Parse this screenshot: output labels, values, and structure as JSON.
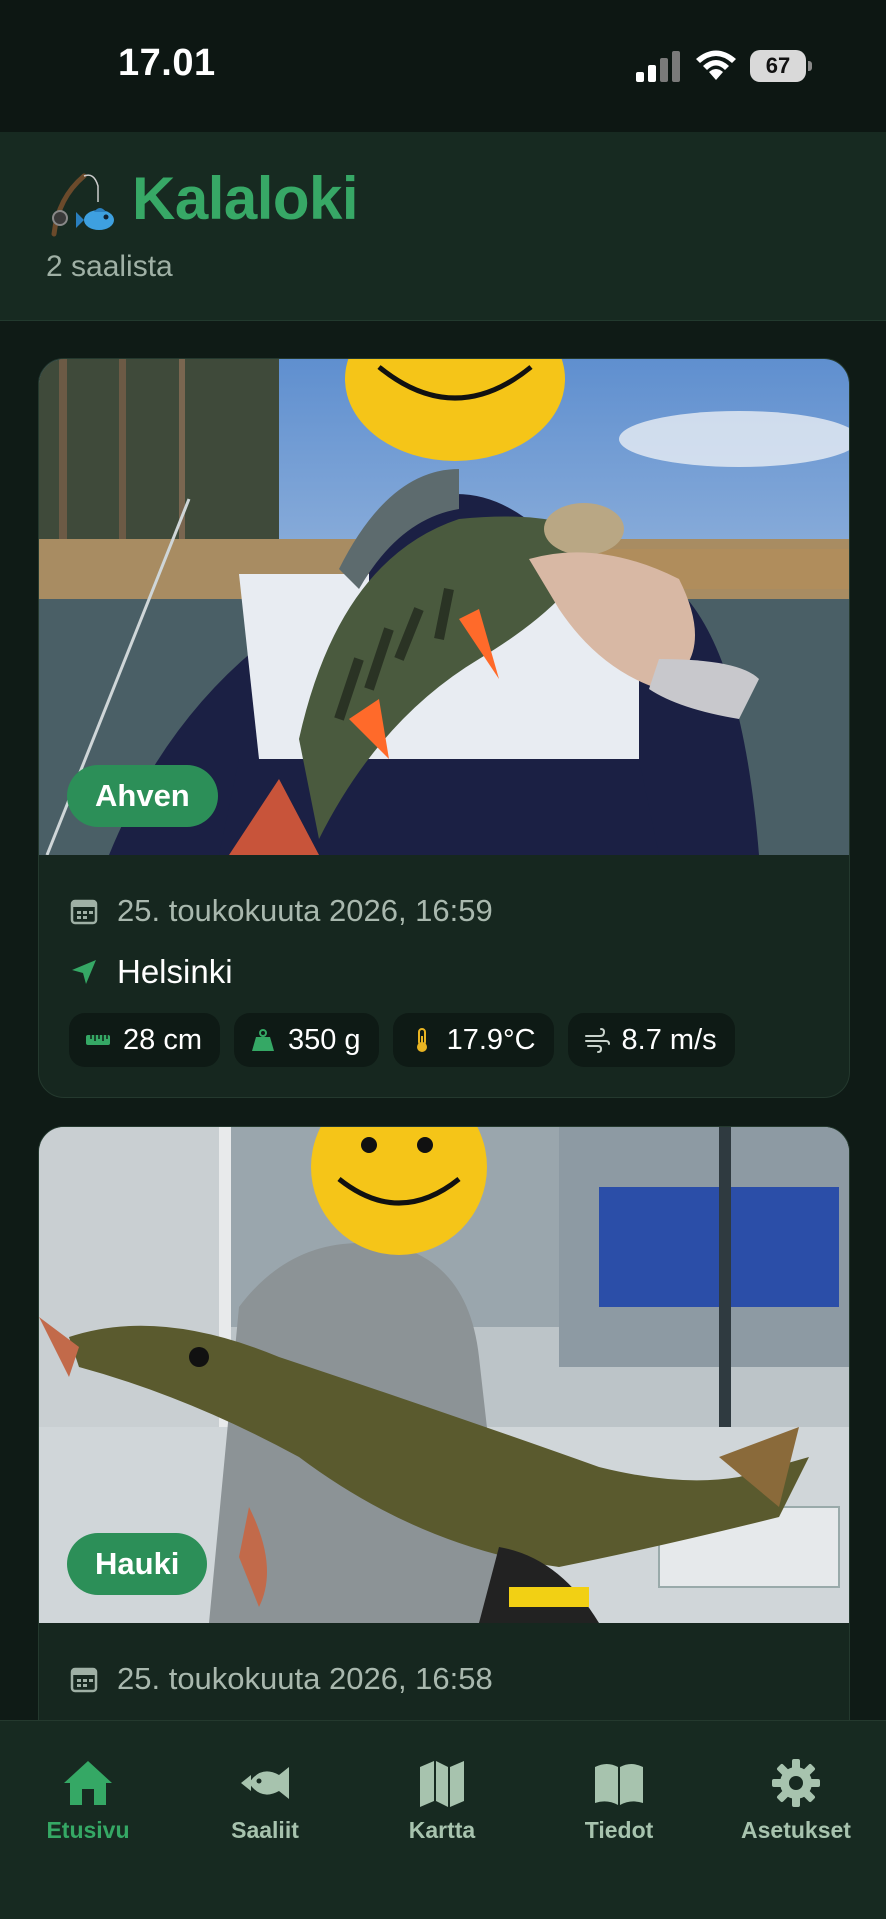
{
  "status_bar": {
    "time": "17.01",
    "battery": "67"
  },
  "header": {
    "title": "Kalaloki",
    "subtitle": "2 saalista",
    "icon": "fishing-icon"
  },
  "catches": [
    {
      "species": "Ahven",
      "date": "25. toukokuuta 2026, 16:59",
      "location": "Helsinki",
      "length": "28 cm",
      "weight": "350 g",
      "temperature": "17.9°C",
      "wind": "8.7 m/s"
    },
    {
      "species": "Hauki",
      "date": "25. toukokuuta 2026, 16:58"
    }
  ],
  "nav": [
    {
      "label": "Etusivu",
      "icon": "home-icon",
      "active": true
    },
    {
      "label": "Saaliit",
      "icon": "fish-icon"
    },
    {
      "label": "Kartta",
      "icon": "map-icon"
    },
    {
      "label": "Tiedot",
      "icon": "book-icon"
    },
    {
      "label": "Asetukset",
      "icon": "gear-icon"
    }
  ],
  "colors": {
    "accent": "#35a865",
    "background": "#0f1b16",
    "card": "#16271f",
    "pill": "#2c8f58"
  }
}
